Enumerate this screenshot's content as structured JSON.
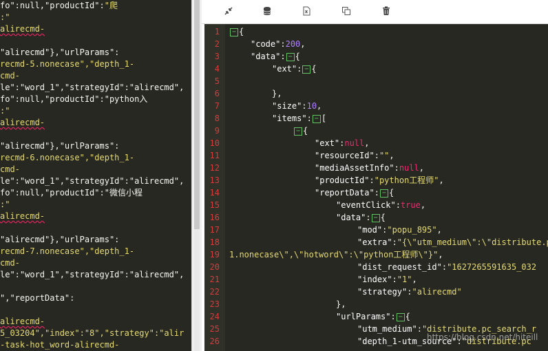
{
  "left_pane": {
    "lines": [
      [
        {
          "t": "fo\":null,\"productId\":"
        },
        {
          "t": "\"爬",
          "c": "s"
        }
      ],
      [
        {
          "t": ":\"",
          "c": "s"
        }
      ],
      [
        {
          "t": "alirecmd-",
          "c": "s sq"
        }
      ],
      [
        {
          "t": ""
        }
      ],
      [
        {
          "t": "\"alirecmd\"},\"urlParams\":"
        }
      ],
      [
        {
          "t": "recmd-5.nonecase\",\"depth_1-",
          "c": "s"
        }
      ],
      [
        {
          "t": "cmd-",
          "c": "s"
        }
      ],
      [
        {
          "t": "le\":\"word_1\",\"strategyId\":\"alirecmd\","
        }
      ],
      [
        {
          "t": "fo\":null,\"productId\":\"python入"
        }
      ],
      [
        {
          "t": ":\"",
          "c": "s"
        }
      ],
      [
        {
          "t": "alirecmd-",
          "c": "s sq"
        }
      ],
      [
        {
          "t": ""
        }
      ],
      [
        {
          "t": "\"alirecmd\"},\"urlParams\":"
        }
      ],
      [
        {
          "t": "recmd-6.nonecase\",\"depth_1-",
          "c": "s"
        }
      ],
      [
        {
          "t": "cmd-",
          "c": "s"
        }
      ],
      [
        {
          "t": "le\":\"word_1\",\"strategyId\":\"alirecmd\","
        }
      ],
      [
        {
          "t": "fo\":null,\"productId\":\"微信小程"
        }
      ],
      [
        {
          "t": ":\"",
          "c": "s"
        }
      ],
      [
        {
          "t": "alirecmd-",
          "c": "s sq"
        }
      ],
      [
        {
          "t": ""
        }
      ],
      [
        {
          "t": "\"alirecmd\"},\"urlParams\":"
        }
      ],
      [
        {
          "t": "recmd-7.nonecase\",\"depth_1-",
          "c": "s"
        }
      ],
      [
        {
          "t": "cmd-",
          "c": "s"
        }
      ],
      [
        {
          "t": "le\":\"word_1\",\"strategyId\":\"alirecmd\","
        }
      ],
      [
        {
          "t": ""
        }
      ],
      [
        {
          "t": "\",\"reportData\":"
        }
      ],
      [
        {
          "t": ""
        }
      ],
      [
        {
          "t": "alirecmd-",
          "c": "s sq"
        }
      ],
      [
        {
          "t": "5_03204\",\"index\":\"8\",\"strategy\":\"alir",
          "c": "s"
        }
      ],
      [
        {
          "t": "-task-hot_word-alirecmd-",
          "c": "s"
        }
      ]
    ]
  },
  "toolbar": {
    "buttons": [
      {
        "name": "compress-button",
        "icon": "compress-icon"
      },
      {
        "name": "database-button",
        "icon": "database-icon"
      },
      {
        "name": "excel-export-button",
        "icon": "excel-file-icon"
      },
      {
        "name": "copy-button",
        "icon": "copy-icon"
      },
      {
        "name": "delete-button",
        "icon": "trash-icon"
      }
    ]
  },
  "code": {
    "lines": [
      {
        "n": "1",
        "indent": 0,
        "parts": [
          {
            "fold": "−"
          },
          {
            "t": "{"
          }
        ]
      },
      {
        "n": "2",
        "indent": 1,
        "parts": [
          {
            "t": "\"code\"",
            "c": "k"
          },
          {
            "t": ":"
          },
          {
            "t": "200",
            "c": "num"
          },
          {
            "t": ","
          }
        ]
      },
      {
        "n": "3",
        "indent": 1,
        "parts": [
          {
            "t": "\"data\"",
            "c": "k"
          },
          {
            "t": ":"
          },
          {
            "fold": "−"
          },
          {
            "t": "{"
          }
        ]
      },
      {
        "n": "4",
        "indent": 2,
        "parts": [
          {
            "t": "\"ext\"",
            "c": "k"
          },
          {
            "t": ":"
          },
          {
            "fold": "−"
          },
          {
            "t": "{"
          }
        ]
      },
      {
        "n": "5",
        "indent": 0,
        "parts": []
      },
      {
        "n": "6",
        "indent": 2,
        "parts": [
          {
            "t": "},"
          }
        ]
      },
      {
        "n": "7",
        "indent": 2,
        "parts": [
          {
            "t": "\"size\"",
            "c": "k"
          },
          {
            "t": ":"
          },
          {
            "t": "10",
            "c": "num"
          },
          {
            "t": ","
          }
        ]
      },
      {
        "n": "8",
        "indent": 2,
        "parts": [
          {
            "t": "\"items\"",
            "c": "k"
          },
          {
            "t": ":"
          },
          {
            "fold": "−"
          },
          {
            "t": "["
          }
        ]
      },
      {
        "n": "9",
        "indent": 3,
        "parts": [
          {
            "fold": "−"
          },
          {
            "t": "{"
          }
        ]
      },
      {
        "n": "10",
        "indent": 4,
        "parts": [
          {
            "t": "\"ext\"",
            "c": "k"
          },
          {
            "t": ":"
          },
          {
            "t": "null",
            "c": "kw"
          },
          {
            "t": ","
          }
        ]
      },
      {
        "n": "11",
        "indent": 4,
        "parts": [
          {
            "t": "\"resourceId\"",
            "c": "k"
          },
          {
            "t": ":"
          },
          {
            "t": "\"\"",
            "c": "str"
          },
          {
            "t": ","
          }
        ]
      },
      {
        "n": "12",
        "indent": 4,
        "parts": [
          {
            "t": "\"mediaAssetInfo\"",
            "c": "k"
          },
          {
            "t": ":"
          },
          {
            "t": "null",
            "c": "kw"
          },
          {
            "t": ","
          }
        ]
      },
      {
        "n": "13",
        "indent": 4,
        "parts": [
          {
            "t": "\"productId\"",
            "c": "k"
          },
          {
            "t": ":"
          },
          {
            "t": "\"python工程师\"",
            "c": "str"
          },
          {
            "t": ","
          }
        ]
      },
      {
        "n": "14",
        "indent": 4,
        "parts": [
          {
            "t": "\"reportData\"",
            "c": "k"
          },
          {
            "t": ":"
          },
          {
            "fold": "−"
          },
          {
            "t": "{"
          }
        ]
      },
      {
        "n": "15",
        "indent": 5,
        "parts": [
          {
            "t": "\"eventClick\"",
            "c": "k"
          },
          {
            "t": ":"
          },
          {
            "t": "true",
            "c": "kw"
          },
          {
            "t": ","
          }
        ]
      },
      {
        "n": "16",
        "indent": 5,
        "parts": [
          {
            "t": "\"data\"",
            "c": "k"
          },
          {
            "t": ":"
          },
          {
            "fold": "−"
          },
          {
            "t": "{"
          }
        ]
      },
      {
        "n": "17",
        "indent": 6,
        "parts": [
          {
            "t": "\"mod\"",
            "c": "k"
          },
          {
            "t": ":"
          },
          {
            "t": "\"popu_895\"",
            "c": "str"
          },
          {
            "t": ","
          }
        ]
      },
      {
        "n": "18",
        "indent": 6,
        "parts": [
          {
            "t": "\"extra\"",
            "c": "k"
          },
          {
            "t": ":"
          },
          {
            "t": "\"{\\\"utm_medium\\\":\\\"distribute.p",
            "c": "str"
          }
        ]
      },
      {
        "n": "19",
        "indent": 0,
        "raw_left": true,
        "parts": [
          {
            "t": "1.nonecase\\\",\\\"hotword\\\":\\\"python工程师\\\"}\"",
            "c": "str"
          },
          {
            "t": ","
          }
        ]
      },
      {
        "n": "20",
        "indent": 6,
        "parts": [
          {
            "t": "\"dist_request_id\"",
            "c": "k"
          },
          {
            "t": ":"
          },
          {
            "t": "\"1627265591635_032",
            "c": "str"
          }
        ]
      },
      {
        "n": "21",
        "indent": 6,
        "parts": [
          {
            "t": "\"index\"",
            "c": "k"
          },
          {
            "t": ":"
          },
          {
            "t": "\"1\"",
            "c": "str"
          },
          {
            "t": ","
          }
        ]
      },
      {
        "n": "22",
        "indent": 6,
        "parts": [
          {
            "t": "\"strategy\"",
            "c": "k"
          },
          {
            "t": ":"
          },
          {
            "t": "\"alirecmd\"",
            "c": "str"
          }
        ]
      },
      {
        "n": "23",
        "indent": 5,
        "parts": [
          {
            "t": "},"
          }
        ]
      },
      {
        "n": "24",
        "indent": 5,
        "parts": [
          {
            "t": "\"urlParams\"",
            "c": "k"
          },
          {
            "t": ":"
          },
          {
            "fold": "−"
          },
          {
            "t": "{"
          }
        ]
      },
      {
        "n": "25",
        "indent": 6,
        "parts": [
          {
            "t": "\"utm_medium\"",
            "c": "k"
          },
          {
            "t": ":"
          },
          {
            "t": "\"distribute.pc_search_r",
            "c": "str"
          }
        ]
      },
      {
        "n": "26",
        "indent": 6,
        "parts": [
          {
            "t": "\"depth_1-utm_source\"",
            "c": "k"
          },
          {
            "t": ":"
          },
          {
            "t": "\"distribute.pc",
            "c": "str"
          }
        ]
      }
    ]
  },
  "watermark": "https://blog.csdn.net/hiteill"
}
